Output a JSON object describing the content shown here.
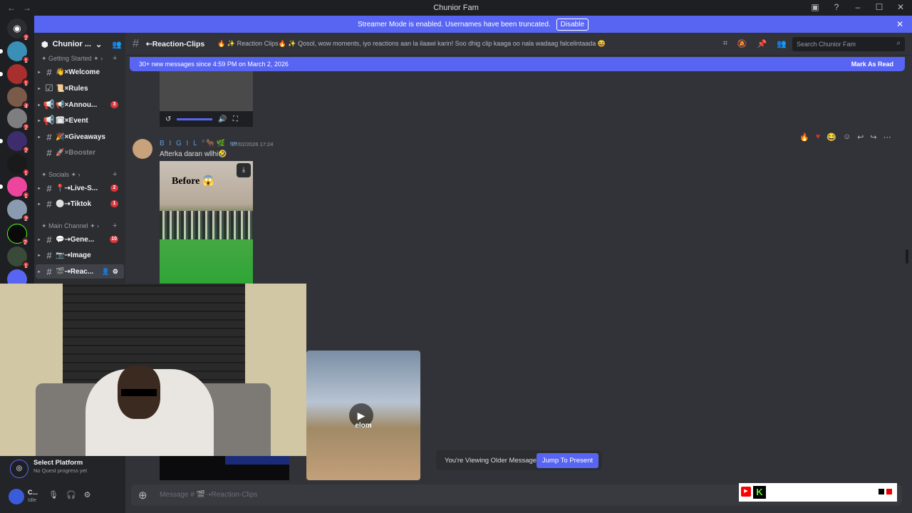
{
  "window": {
    "title": "Chunior Fam"
  },
  "banner": {
    "text": "Streamer Mode is enabled. Usernames have been truncated.",
    "button": "Disable"
  },
  "guild": {
    "name": "Chunior ..."
  },
  "servers": [
    {
      "badge": "2"
    },
    {
      "badge": "1"
    },
    {
      "badge": "1"
    },
    {
      "badge": "4"
    },
    {
      "badge": "2"
    },
    {
      "badge": "2"
    },
    {
      "badge": "1"
    },
    {
      "badge": "1"
    },
    {
      "badge": "2"
    },
    {
      "badge": "2"
    },
    {
      "badge": "1"
    }
  ],
  "categories": {
    "getting_started": "Getting Started ✦",
    "socials": "Socials ✦",
    "main_channel": "Main Channel ✦"
  },
  "channels": [
    {
      "label": "👋×Welcome",
      "badge": ""
    },
    {
      "label": "📜×Rules",
      "badge": ""
    },
    {
      "label": "📢×Annou...",
      "badge": "3"
    },
    {
      "label": "🗓×Event",
      "badge": ""
    },
    {
      "label": "🎉×Giveaways",
      "badge": ""
    },
    {
      "label": "🚀×Booster",
      "badge": ""
    },
    {
      "label": "📍⇢Live-S...",
      "badge": "2"
    },
    {
      "label": "⚪⇢Tiktok",
      "badge": "1"
    },
    {
      "label": "💬⇢Gene...",
      "badge": "10"
    },
    {
      "label": "📷⇢Image",
      "badge": ""
    },
    {
      "label": "🎬⇢Reac...",
      "badge": ""
    }
  ],
  "header": {
    "channel_name": "⇠Reaction-Clips",
    "topic": "🔥 ✨ Reaction Clips🔥 ✨ Qosol, wow moments, iyo reactions aan la ilaawi karin! Soo dhig clip kaaga oo nala wadaag falcelintaada 😆",
    "search_placeholder": "Search Chunior Fam"
  },
  "new_messages": {
    "text": "30+ new messages since 4:59 PM on March 2, 2026",
    "action": "Mark As Read"
  },
  "message": {
    "author": "B I G I L °🐂🌿",
    "tag": "BR",
    "timestamp": "27/02/2026 17:24",
    "text": "Afterka daran wllhi🤣",
    "video_caption": "Before 😱"
  },
  "clip2": {
    "caption": "elom"
  },
  "older_notice": {
    "text": "You're Viewing Older Messages",
    "button": "Jump To Present"
  },
  "composer": {
    "placeholder": "Message # 🎬⇢Reaction-Clips"
  },
  "quest": {
    "title": "Select Platform",
    "subtitle": "No Quest progress yet"
  },
  "user": {
    "name": "C...",
    "status": "Idle"
  },
  "overlay": {
    "yt": "▶",
    "kick": "K"
  },
  "colors": {
    "accent": "#5865f2",
    "badge": "#da373c",
    "kick": "#53fc18"
  }
}
